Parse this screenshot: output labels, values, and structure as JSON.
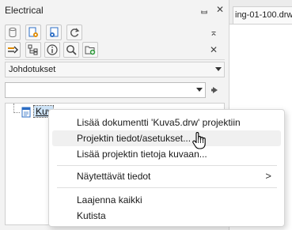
{
  "panel": {
    "title": "Electrical",
    "pin_glyph": "ᆸ",
    "close_glyph": "✕",
    "collapse_glyph": "⌅"
  },
  "document_tab": {
    "label": "ing-01-100.drw"
  },
  "toolbar_row1": {
    "icons": [
      "cylinder-icon",
      "gear-document-icon",
      "link-document-icon",
      "refresh-icon"
    ]
  },
  "toolbar_row2": {
    "icons": [
      "wire-arrow-icon",
      "tree-hierarchy-icon",
      "info-icon",
      "search-icon",
      "new-folder-icon"
    ],
    "close_glyph": "✕"
  },
  "view_dropdown": {
    "selected": "Johdotukset"
  },
  "search_combo": {
    "value": "",
    "go_glyph": "➧"
  },
  "tree": {
    "items": [
      {
        "label": "Kuva5.drw"
      }
    ]
  },
  "context_menu": {
    "items": [
      {
        "label": "Lisää dokumentti 'Kuva5.drw' projektiin"
      },
      {
        "label": "Projektin tiedot/asetukset..."
      },
      {
        "label": "Lisää projektin tietoja kuvaan..."
      },
      {
        "label": "Näytettävät tiedot",
        "submenu_glyph": ">"
      },
      {
        "label": "Laajenna kaikki"
      },
      {
        "label": "Kutista"
      }
    ],
    "hovered_index": 1
  },
  "colors": {
    "accent_blue": "#2b6cc4",
    "green": "#2e9b3a",
    "orange": "#e08a00",
    "selection": "#cde3f7"
  }
}
